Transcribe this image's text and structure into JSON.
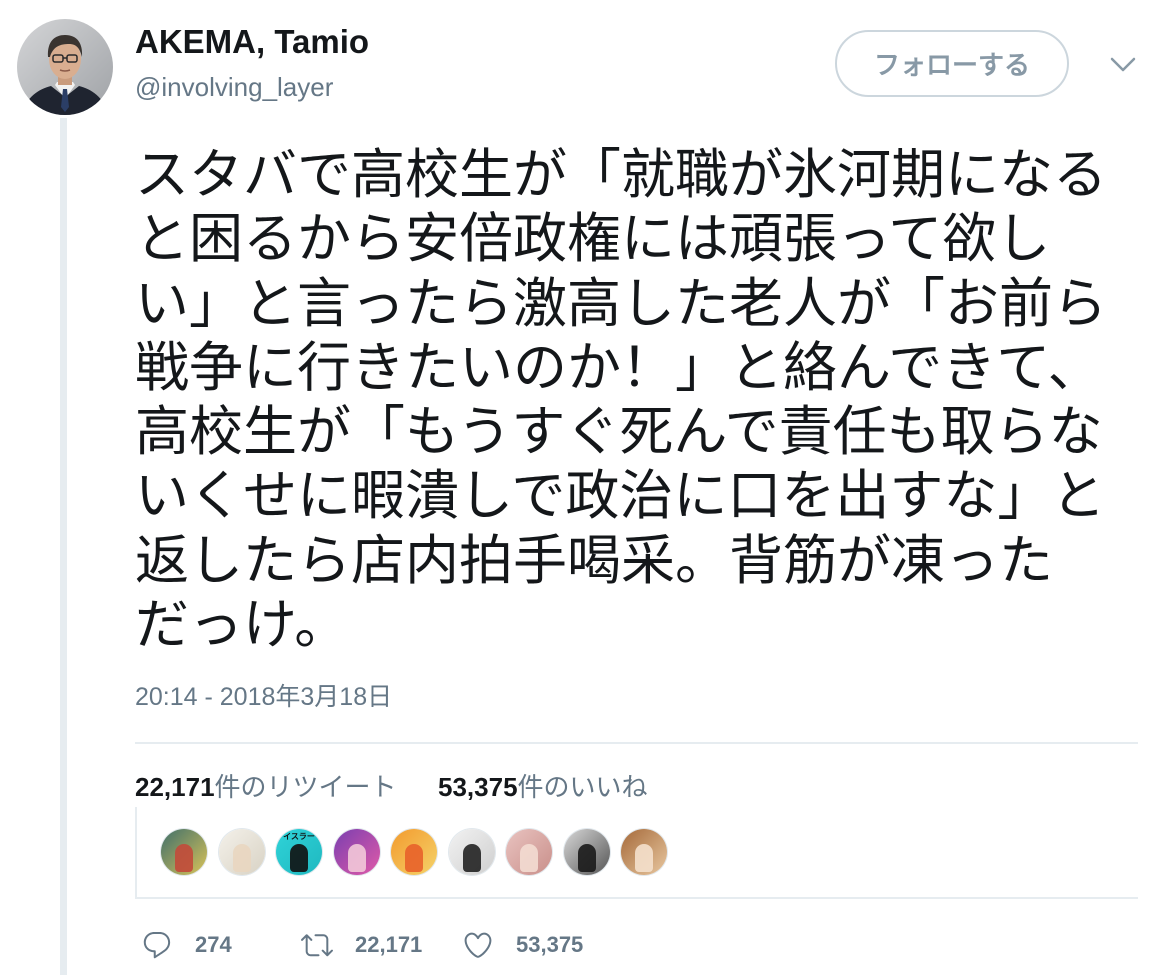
{
  "tweet": {
    "author": {
      "name": "AKEMA, Tamio",
      "handle": "@involving_layer",
      "avatar_icon": "author-avatar"
    },
    "follow_button": {
      "label": "フォローする"
    },
    "menu_icon": "chevron-down-icon",
    "text_lines": [
      "スタバで高校生が「就職が氷河期になる",
      "と困るから安倍政権には頑張って欲し",
      "い」と言ったら激高した老人が「お前ら",
      "戦争に行きたいのか！」と絡んできて、",
      "高校生が「もうすぐ死んで責任も取らな",
      "いくせに暇潰しで政治に口を出すな」と",
      "返したら店内拍手喝采。背筋が凍った",
      "だっけ。"
    ],
    "timestamp": "20:14 - 2018年3月18日",
    "stats": {
      "retweets": {
        "count": "22,171",
        "label": "件のリツイート"
      },
      "likes": {
        "count": "53,375",
        "label": "件のいいね"
      }
    },
    "liked_by_avatars": [
      {
        "bg": "#3f6f6a",
        "accent": "#d9c35a",
        "fg": "#c24a3a"
      },
      {
        "bg": "#f4f1ea",
        "accent": "#d8d2c4",
        "fg": "#e9d6c0"
      },
      {
        "bg": "#2fd3d8",
        "accent": "#1fb8c0",
        "fg": "#111111",
        "label": "イスラー"
      },
      {
        "bg": "#7a3fb0",
        "accent": "#e05aa8",
        "fg": "#f2c8d8"
      },
      {
        "bg": "#f29a2e",
        "accent": "#f5d36a",
        "fg": "#e8622a"
      },
      {
        "bg": "#f2f2f2",
        "accent": "#cfcfcf",
        "fg": "#222222"
      },
      {
        "bg": "#e9c3c0",
        "accent": "#c98f8a",
        "fg": "#f3dcd2"
      },
      {
        "bg": "#d8d8d8",
        "accent": "#555555",
        "fg": "#1a1a1a"
      },
      {
        "bg": "#a56a3a",
        "accent": "#e8c7a0",
        "fg": "#f4e0cc"
      }
    ],
    "actions": {
      "reply": {
        "icon": "reply-icon",
        "count": "274"
      },
      "retweet": {
        "icon": "retweet-icon",
        "count": "22,171"
      },
      "like": {
        "icon": "heart-icon",
        "count": "53,375"
      }
    }
  },
  "theme": {
    "text": "#14171a",
    "muted": "#657786",
    "line": "#e6ecf0",
    "border": "#ccd6dd",
    "follow_text": "#8899a6"
  }
}
